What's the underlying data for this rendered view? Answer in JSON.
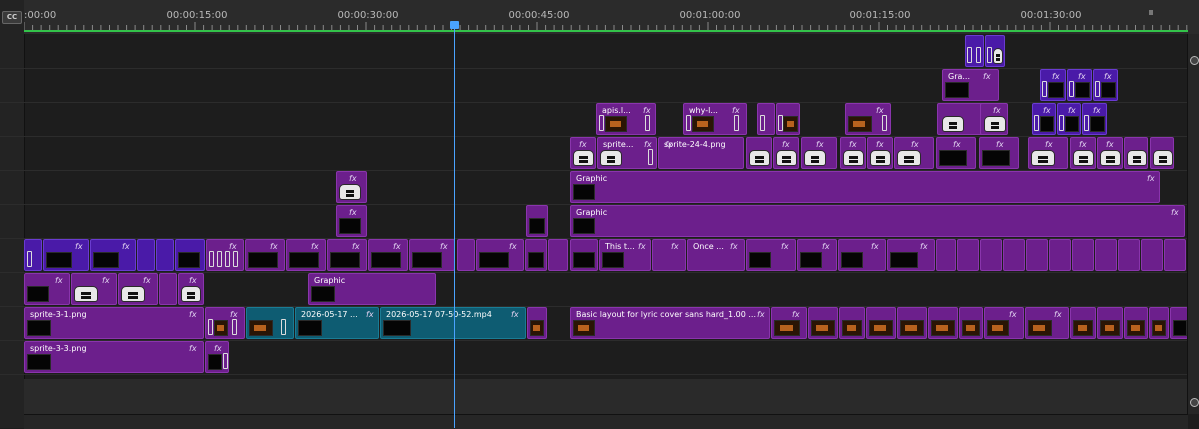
{
  "header": {
    "cc_label": "CC"
  },
  "ruler": {
    "timecodes": [
      ":00:00",
      "00:00:15:00",
      "00:00:30:00",
      "00:00:45:00",
      "00:01:00:00",
      "00:01:15:00",
      "00:01:30:00"
    ]
  },
  "colors": {
    "video_clip": "#6c1f8c",
    "blue_clip": "#4a1aa8",
    "teal_clip": "#0e5c72",
    "playhead": "#4aa3ff",
    "work_area": "#33c24a"
  },
  "clip_labels": {
    "fx": "fx",
    "graphic": "Graphic",
    "sprite_3_1": "sprite-3-1.png",
    "sprite_3_3": "sprite-3-3.png",
    "video_0517_short": "2026-05-17 ...",
    "video_0517_mp4": "2026-05-17 07-50-52.mp4",
    "basic_layout": "Basic layout for lyric cover sans hard_1.00 ...",
    "this": "This t...",
    "once": "Once ...",
    "sprite_short": "sprite...",
    "sprite_24_4": "sprite-24-4.png",
    "apis": "apis.l...",
    "why": "why-l...",
    "gra": "Gra..."
  }
}
